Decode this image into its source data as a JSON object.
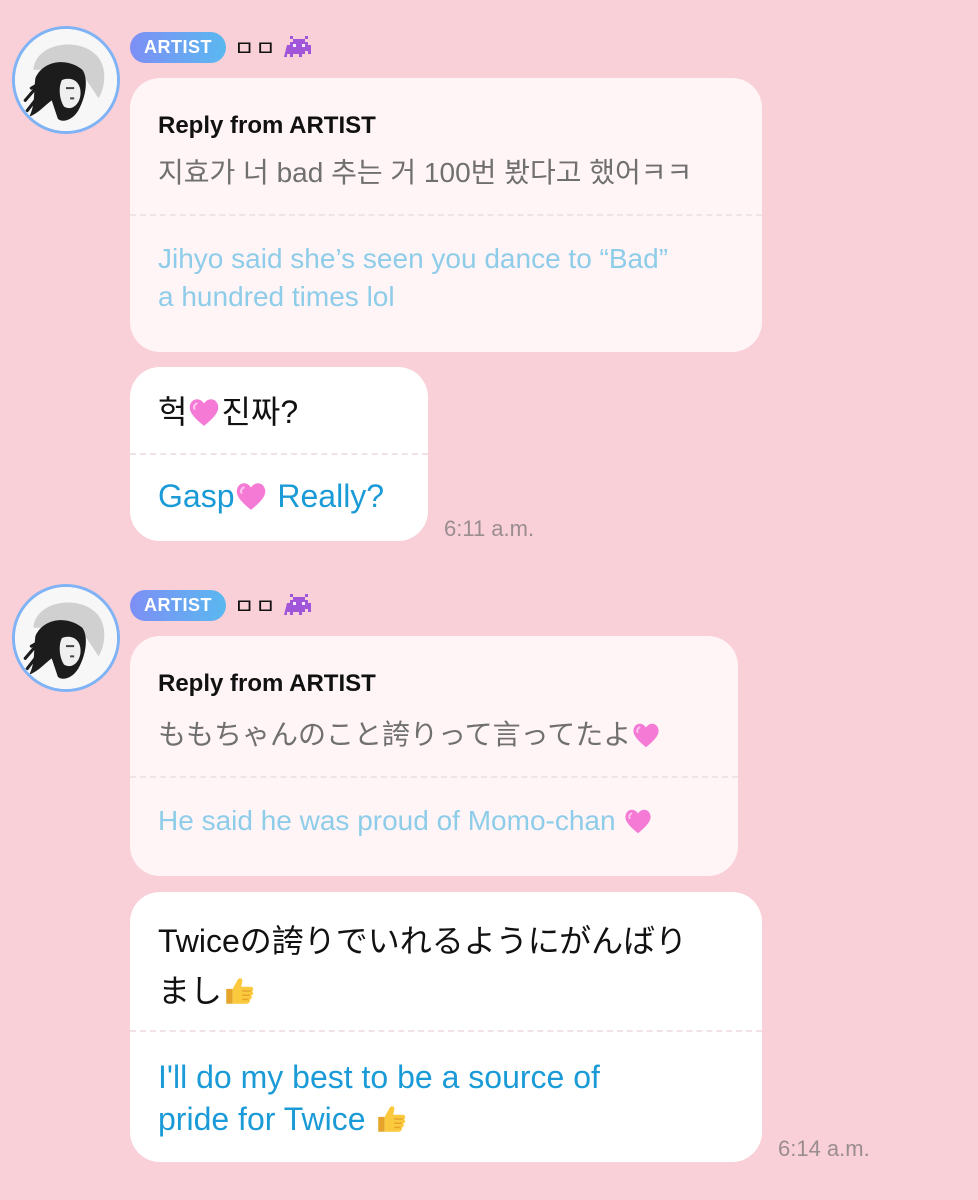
{
  "threads": [
    {
      "sender": {
        "badge": "ARTIST",
        "name": "ㅁㅁ",
        "icon": "alien-monster-icon"
      },
      "reply": {
        "title": "Reply from ARTIST",
        "original": "지효가 너 bad 추는 거 100번 봤다고 했어ㅋㅋ",
        "translation_line1": "Jihyo said she’s seen you dance to “Bad”",
        "translation_line2": "a hundred times lol"
      },
      "message": {
        "text_before": "헉",
        "text_after": "진짜?",
        "translation_before": "Gasp",
        "translation_after": " Really?",
        "emoji": "pink-heart-icon"
      },
      "time": "6:11 a.m."
    },
    {
      "sender": {
        "badge": "ARTIST",
        "name": "ㅁㅁ",
        "icon": "alien-monster-icon"
      },
      "reply": {
        "title": "Reply from ARTIST",
        "original": "ももちゃんのこと誇りって言ってたよ",
        "translation": "He said he was proud of Momo-chan ",
        "emoji": "pink-heart-icon"
      },
      "message": {
        "text_line1": "Twiceの誇りでいれるようにがんばり",
        "text_line2": "まし",
        "translation_line1": "I'll do my best to be a source of",
        "translation_line2": "pride for Twice ",
        "emoji": "thumbs-up-icon"
      },
      "time": "6:14 a.m."
    }
  ],
  "colors": {
    "background": "#f9cfd8",
    "reply_bubble": "#fff4f6",
    "message_bubble": "#ffffff",
    "translation_reply": "#8ecde9",
    "translation_message": "#1a9bd7",
    "avatar_ring": "#7fb3f5"
  }
}
